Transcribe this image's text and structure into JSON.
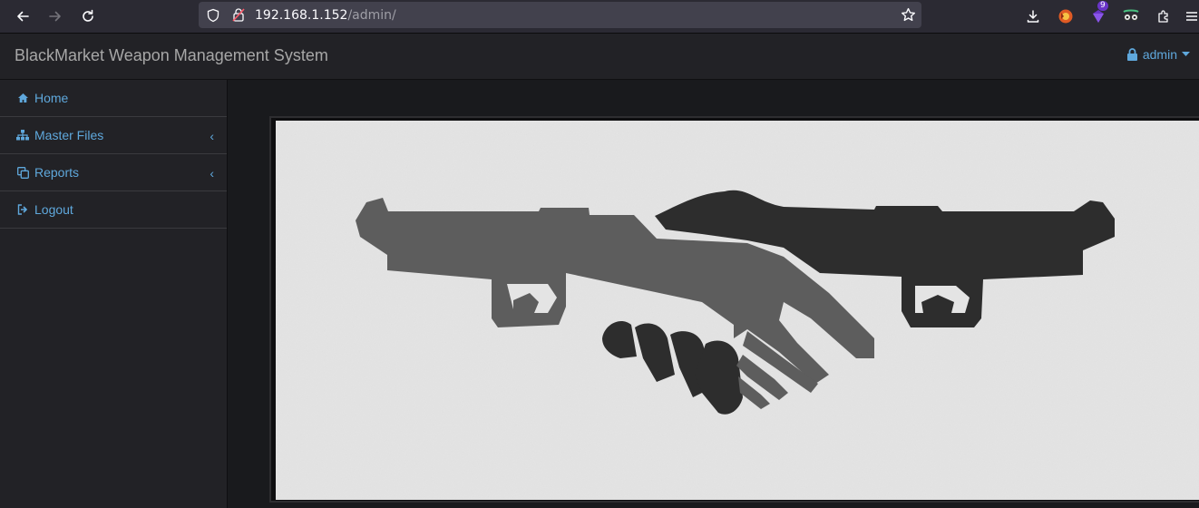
{
  "browser": {
    "url_host": "192.168.1.152",
    "url_path": "/admin/",
    "badge_count": "9"
  },
  "app": {
    "title": "BlackMarket Weapon Management System",
    "user": "admin"
  },
  "sidebar": {
    "items": [
      {
        "label": "Home",
        "icon": "home-icon",
        "has_children": false
      },
      {
        "label": "Master Files",
        "icon": "sitemap-icon",
        "has_children": true
      },
      {
        "label": "Reports",
        "icon": "reports-icon",
        "has_children": true
      },
      {
        "label": "Logout",
        "icon": "logout-icon",
        "has_children": false
      }
    ]
  },
  "main": {
    "image": "gun-handshake-logo"
  },
  "colors": {
    "link": "#5fa8dc",
    "background": "#222226",
    "content_background": "#191a1d"
  }
}
